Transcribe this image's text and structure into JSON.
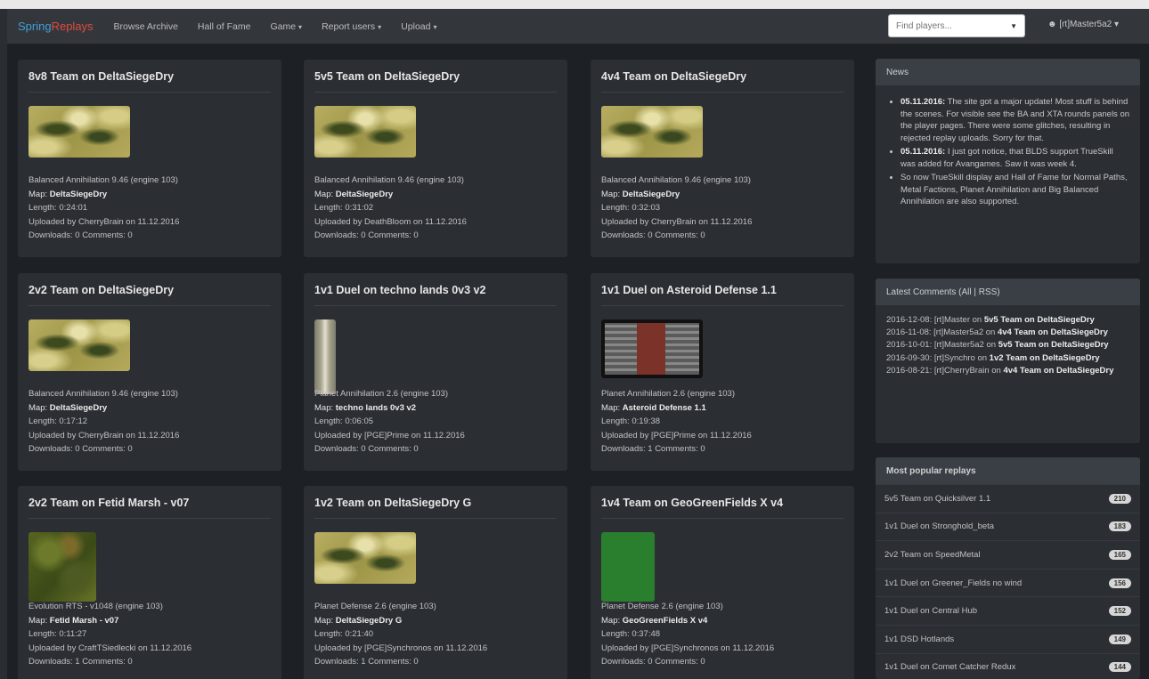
{
  "navbar": {
    "brand_part1": "Spring",
    "brand_part2": "Replays",
    "items": [
      {
        "label": "Browse Archive",
        "caret": ""
      },
      {
        "label": "Hall of Fame",
        "caret": ""
      },
      {
        "label": "Game",
        "caret": "▾"
      },
      {
        "label": "Report users",
        "caret": "▾"
      },
      {
        "label": "Upload",
        "caret": "▾"
      }
    ],
    "search_placeholder": "Find players...",
    "user_label": "[rt]Master5a2 ▾",
    "colors": {
      "brand1": "#3e9fd8",
      "brand2": "#e24a3b",
      "bar": "#33373c"
    }
  },
  "cards": [
    {
      "title": "8v8 Team on DeltaSiegeDry",
      "thumb": "desert",
      "game": "Balanced Annihilation 9.46 (engine 103)",
      "map": "DeltaSiegeDry",
      "length": "0:24:01",
      "uploaded": "Uploaded by CherryBrain on 11.12.2016",
      "downloads": "Downloads: 0 Comments: 0"
    },
    {
      "title": "5v5 Team on DeltaSiegeDry",
      "thumb": "desert",
      "game": "Balanced Annihilation 9.46 (engine 103)",
      "map": "DeltaSiegeDry",
      "length": "0:31:02",
      "uploaded": "Uploaded by DeathBloom on 11.12.2016",
      "downloads": "Downloads: 0 Comments: 0"
    },
    {
      "title": "4v4 Team on DeltaSiegeDry",
      "thumb": "desert",
      "game": "Balanced Annihilation 9.46 (engine 103)",
      "map": "DeltaSiegeDry",
      "length": "0:32:03",
      "uploaded": "Uploaded by CherryBrain on 11.12.2016",
      "downloads": "Downloads: 0 Comments: 0"
    },
    {
      "title": "2v2 Team on DeltaSiegeDry",
      "thumb": "desert",
      "game": "Balanced Annihilation 9.46 (engine 103)",
      "map": "DeltaSiegeDry",
      "length": "0:17:12",
      "uploaded": "Uploaded by CherryBrain on 11.12.2016",
      "downloads": "Downloads: 0 Comments: 0"
    },
    {
      "title": "1v1 Duel on techno lands 0v3 v2",
      "thumb": "techno",
      "game": "Planet Annihilation 2.6 (engine 103)",
      "map": "techno lands 0v3 v2",
      "length": "0:06:05",
      "uploaded": "Uploaded by [PGE]Prime on 11.12.2016",
      "downloads": "Downloads: 0 Comments: 0"
    },
    {
      "title": "1v1 Duel on Asteroid Defense 1.1",
      "thumb": "asteroid",
      "game": "Planet Annihilation 2.6 (engine 103)",
      "map": "Asteroid Defense 1.1",
      "length": "0:19:38",
      "uploaded": "Uploaded by [PGE]Prime on 11.12.2016",
      "downloads": "Downloads: 1 Comments: 0"
    },
    {
      "title": "2v2 Team on Fetid Marsh - v07",
      "thumb": "marsh",
      "game": "Evolution RTS - v1048 (engine 103)",
      "map": "Fetid Marsh - v07",
      "length": "0:11:27",
      "uploaded": "Uploaded by CraftTSiedlecki on 11.12.2016",
      "downloads": "Downloads: 1 Comments: 0"
    },
    {
      "title": "1v2 Team on DeltaSiegeDry G",
      "thumb": "desert",
      "game": "Planet Defense 2.6 (engine 103)",
      "map": "DeltaSiegeDry G",
      "length": "0:21:40",
      "uploaded": "Uploaded by [PGE]Synchronos on 11.12.2016",
      "downloads": "Downloads: 1 Comments: 0"
    },
    {
      "title": "1v4 Team on GeoGreenFields X v4",
      "thumb": "green",
      "game": "Planet Defense 2.6 (engine 103)",
      "map": "GeoGreenFields X v4",
      "length": "0:37:48",
      "uploaded": "Uploaded by [PGE]Synchronos on 11.12.2016",
      "downloads": "Downloads: 0 Comments: 0"
    }
  ],
  "labels": {
    "map": "Map:",
    "length": "Length:"
  },
  "news": {
    "title": "News",
    "items": [
      {
        "date": "05.11.2016:",
        "text": "The site got a major update! Most stuff is behind the scenes. For visible see the BA and XTA rounds panels on the player pages. There were some glitches, resulting in rejected replay uploads. Sorry for that."
      },
      {
        "date": "05.11.2016:",
        "text": "I just got notice, that BLDS support TrueSkill was added for Avangames. Saw it was week 4."
      },
      {
        "date": "",
        "text": "So now TrueSkill display and Hall of Fame for Normal Paths, Metal Factions, Planet Annihilation and Big Balanced Annihilation are also supported."
      }
    ]
  },
  "comments": {
    "title": "Latest Comments (All | RSS)",
    "items": [
      {
        "meta": "2016-12-08: [rt]Master on",
        "target": "5v5 Team on DeltaSiegeDry"
      },
      {
        "meta": "2016-11-08: [rt]Master5a2 on",
        "target": "4v4 Team on DeltaSiegeDry"
      },
      {
        "meta": "2016-10-01: [rt]Master5a2 on",
        "target": "5v5 Team on DeltaSiegeDry"
      },
      {
        "meta": "2016-09-30: [rt]Synchro on",
        "target": "1v2 Team on DeltaSiegeDry"
      },
      {
        "meta": "2016-08-21: [rt]CherryBrain on",
        "target": "4v4 Team on DeltaSiegeDry"
      }
    ]
  },
  "popular": {
    "title": "Most popular replays",
    "items": [
      {
        "label": "5v5 Team on Quicksilver 1.1",
        "count": "210"
      },
      {
        "label": "1v1 Duel on Stronghold_beta",
        "count": "183"
      },
      {
        "label": "2v2 Team on SpeedMetal",
        "count": "165"
      },
      {
        "label": "1v1 Duel on Greener_Fields no wind",
        "count": "156"
      },
      {
        "label": "1v1 Duel on Central Hub",
        "count": "152"
      },
      {
        "label": "1v1 DSD Hotlands",
        "count": "149"
      },
      {
        "label": "1v1 Duel on Comet Catcher Redux",
        "count": "144"
      }
    ]
  }
}
